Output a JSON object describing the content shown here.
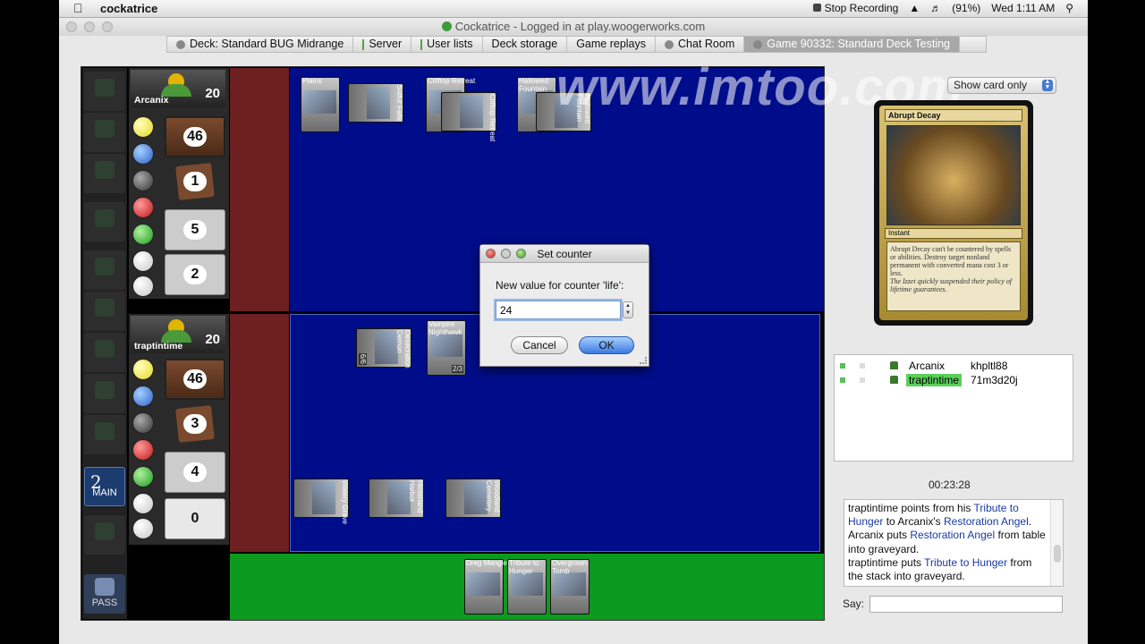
{
  "menubar": {
    "app_name": "cockatrice",
    "recording": "Stop Recording",
    "battery": "(91%)",
    "clock": "Wed 1:11 AM"
  },
  "window": {
    "title": "Cockatrice - Logged in at play.woogerworks.com"
  },
  "tabs": [
    {
      "label": "Deck: Standard BUG Midrange"
    },
    {
      "label": "Server"
    },
    {
      "label": "User lists"
    },
    {
      "label": "Deck storage"
    },
    {
      "label": "Game replays"
    },
    {
      "label": "Chat Room"
    },
    {
      "label": "Game 90332: Standard Deck Testing"
    }
  ],
  "phases": {
    "main2_label": "MAIN",
    "main2_num": "2",
    "pass_label": "PASS"
  },
  "players": [
    {
      "name": "Arcanix",
      "life": "20",
      "library": "46",
      "hand": "1",
      "graveyard": "5",
      "exile": "2"
    },
    {
      "name": "traptintime",
      "life": "20",
      "library": "46",
      "hand": "3",
      "graveyard": "4",
      "exile": "0"
    }
  ],
  "battlefield": {
    "opponent_cards": [
      "Plains",
      "Sulfur Falls",
      "Clifftop Retreat",
      "Clifftop Retreat",
      "Hallowed Fountain",
      "Hallowed Fountain"
    ],
    "player_cards": [
      "Desecration Demon",
      "Vampire Nighthawk",
      "Watery Grave",
      "Hinterland Harbor",
      "Woodland Cemetery"
    ],
    "vampire_pt": "2/3",
    "demon_pt": "6/6"
  },
  "hand_cards": [
    "Dreg Mangler",
    "Tribute to Hunger",
    "Overgrown Tomb"
  ],
  "watermark": "www.imtoo.com",
  "right_panel": {
    "show_card_select": "Show card only",
    "card_name": "Abrupt Decay",
    "card_type": "Instant",
    "card_text": "Abrupt Decay can't be countered by spells or abilities. Destroy target nonland permanent with converted mana cost 3 or less.",
    "flavor": "The Izzet quickly suspended their policy of lifetime guarantees.",
    "users": [
      {
        "name": "Arcanix",
        "deck": "khpltl88"
      },
      {
        "name": "traptintime",
        "deck": "71m3d20j"
      }
    ],
    "game_clock": "00:23:28",
    "say_label": "Say:",
    "say_value": ""
  },
  "chat_log": [
    {
      "parts": [
        [
          "traptintime points from his ",
          false
        ],
        [
          "Tribute to Hunger",
          true
        ],
        [
          " to Arcanix's ",
          false
        ],
        [
          "Restoration Angel",
          true
        ],
        [
          ".",
          false
        ]
      ]
    },
    {
      "parts": [
        [
          "Arcanix puts ",
          false
        ],
        [
          "Restoration Angel",
          true
        ],
        [
          " from table into graveyard.",
          false
        ]
      ]
    },
    {
      "parts": [
        [
          "traptintime puts ",
          false
        ],
        [
          "Tribute to Hunger",
          true
        ],
        [
          " from the stack into graveyard.",
          false
        ]
      ]
    }
  ],
  "dialog": {
    "title": "Set counter",
    "prompt": "New value for counter 'life':",
    "value": "24",
    "cancel": "Cancel",
    "ok": "OK"
  },
  "colors": {
    "battlefield": "#000d8a",
    "hand_zone": "#0c9a1e",
    "stack_zone": "#6e1f1f",
    "link": "#1a3aa0"
  }
}
